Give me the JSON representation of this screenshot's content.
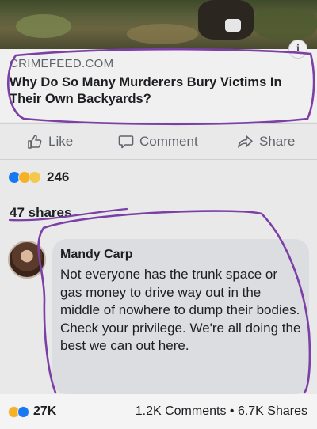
{
  "post": {
    "link": {
      "domain": "CRIMEFEED.COM",
      "title": "Why Do So Many Murderers Bury Victims In Their Own Backyards?"
    },
    "actions": {
      "like": "Like",
      "comment": "Comment",
      "share": "Share"
    },
    "reactions": {
      "count": "246"
    },
    "shares": "47 shares"
  },
  "comment": {
    "author": "Mandy Carp",
    "text": "Not everyone has the trunk space or gas money to drive way out in the middle of nowhere to dump their bodies. Check your privilege. We're all doing the best we can out here."
  },
  "footer": {
    "reactions": "27K",
    "stats": "1.2K Comments • 6.7K Shares"
  },
  "colors": {
    "annotation": "#7b3fa6",
    "like_blue": "#1877f2"
  }
}
